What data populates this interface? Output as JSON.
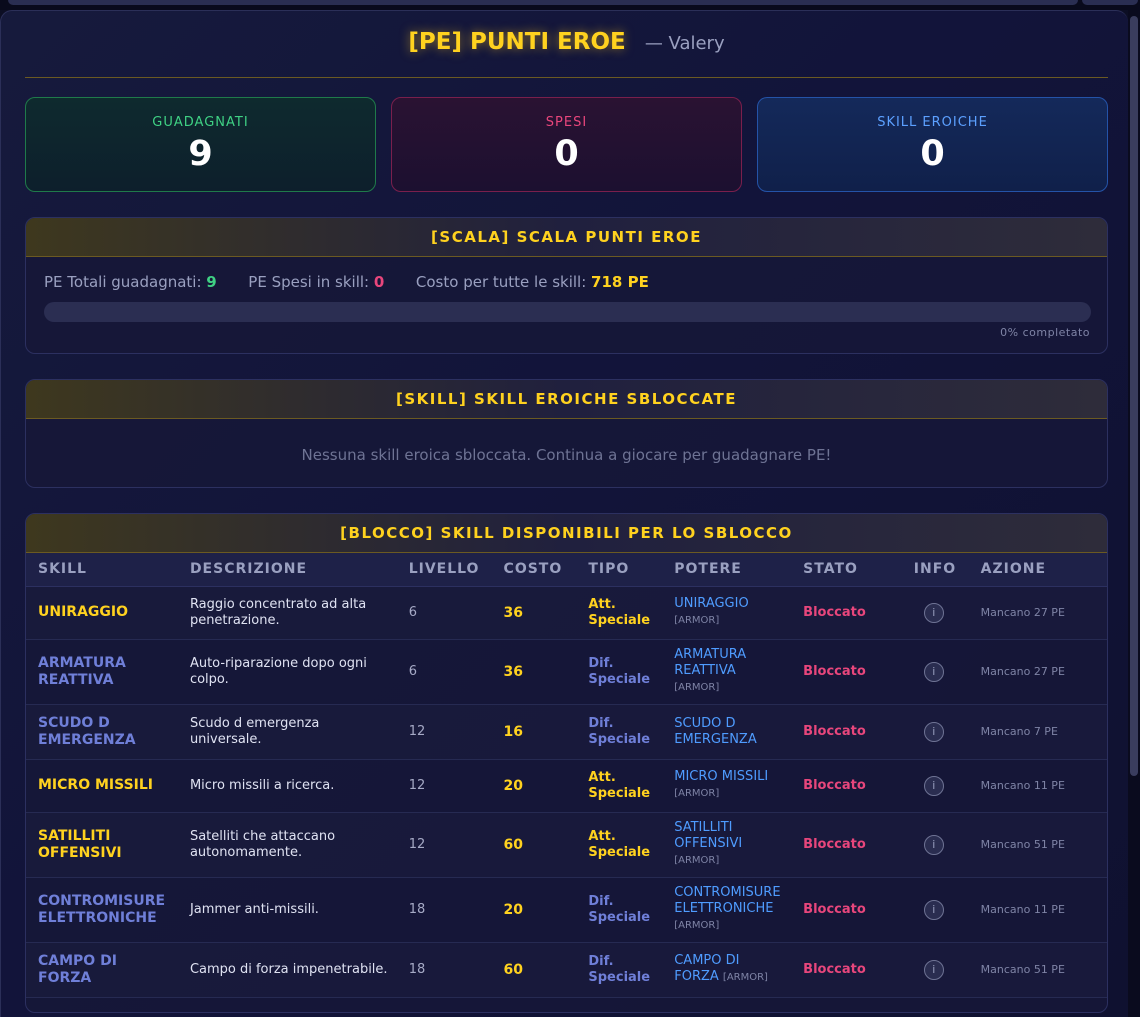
{
  "header": {
    "title": "[PE] PUNTI EROE",
    "subtitle": "— Valery"
  },
  "stats": {
    "earned_label": "GUADAGNATI",
    "earned_value": "9",
    "spent_label": "SPESI",
    "spent_value": "0",
    "heroic_label": "SKILL EROICHE",
    "heroic_value": "0"
  },
  "scala": {
    "title": "[SCALA] SCALA PUNTI EROE",
    "total_label": "PE Totali guadagnati:",
    "total_value": "9",
    "spent_label": "PE Spesi in skill:",
    "spent_value": "0",
    "cost_label": "Costo per tutte le skill:",
    "cost_value": "718 PE",
    "progress_fraction": 0,
    "progress_label": "0% completato"
  },
  "unlocked": {
    "title": "[SKILL] SKILL EROICHE SBLOCCATE",
    "empty_message": "Nessuna skill eroica sbloccata. Continua a giocare per guadagnare PE!"
  },
  "available": {
    "title": "[BLOCCO] SKILL DISPONIBILI PER LO SBLOCCO",
    "columns": [
      "SKILL",
      "DESCRIZIONE",
      "LIVELLO",
      "COSTO",
      "TIPO",
      "POTERE",
      "STATO",
      "INFO",
      "AZIONE"
    ],
    "rows": [
      {
        "skill": "UNIRAGGIO",
        "description": "Raggio concentrato ad alta penetrazione.",
        "level": "6",
        "cost": "36",
        "type": "Att. Speciale",
        "power": "UNIRAGGIO",
        "power_tag": "[ARMOR]",
        "status": "Bloccato",
        "action": "Mancano 27 PE"
      },
      {
        "skill": "ARMATURA REATTIVA",
        "description": "Auto-riparazione dopo ogni colpo.",
        "level": "6",
        "cost": "36",
        "type": "Dif. Speciale",
        "power": "ARMATURA REATTIVA",
        "power_tag": "[ARMOR]",
        "status": "Bloccato",
        "action": "Mancano 27 PE"
      },
      {
        "skill": "SCUDO D EMERGENZA",
        "description": "Scudo d emergenza universale.",
        "level": "12",
        "cost": "16",
        "type": "Dif. Speciale",
        "power": "SCUDO D EMERGENZA",
        "power_tag": "",
        "status": "Bloccato",
        "action": "Mancano 7 PE"
      },
      {
        "skill": "MICRO MISSILI",
        "description": "Micro missili a ricerca.",
        "level": "12",
        "cost": "20",
        "type": "Att. Speciale",
        "power": "MICRO MISSILI",
        "power_tag": "[ARMOR]",
        "status": "Bloccato",
        "action": "Mancano 11 PE"
      },
      {
        "skill": "SATILLITI OFFENSIVI",
        "description": "Satelliti che attaccano autonomamente.",
        "level": "12",
        "cost": "60",
        "type": "Att. Speciale",
        "power": "SATILLITI OFFENSIVI",
        "power_tag": "[ARMOR]",
        "status": "Bloccato",
        "action": "Mancano 51 PE"
      },
      {
        "skill": "CONTROMISURE ELETTRONICHE",
        "description": "Jammer anti-missili.",
        "level": "18",
        "cost": "20",
        "type": "Dif. Speciale",
        "power": "CONTROMISURE ELETTRONICHE",
        "power_tag": "[ARMOR]",
        "status": "Bloccato",
        "action": "Mancano 11 PE"
      },
      {
        "skill": "CAMPO DI FORZA",
        "description": "Campo di forza impenetrabile.",
        "level": "18",
        "cost": "60",
        "type": "Dif. Speciale",
        "power": "CAMPO DI FORZA",
        "power_tag": "[ARMOR]",
        "status": "Bloccato",
        "action": "Mancano 51 PE"
      }
    ],
    "info_icon": "i"
  },
  "colors": {
    "accent_gold": "#ffd21f",
    "green": "#3fd184",
    "pink": "#e8467c",
    "blue": "#5ca0ff",
    "defense_purple": "#6f7fd8"
  }
}
